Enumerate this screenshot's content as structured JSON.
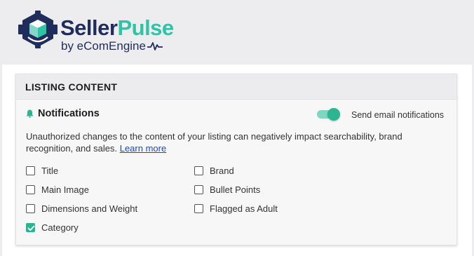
{
  "brand": {
    "name_part1": "Seller",
    "name_part2": "Pulse",
    "sub": "by eComEngine",
    "colors": {
      "navy": "#1f2d5c",
      "teal": "#2ec4a6"
    }
  },
  "card": {
    "header": "LISTING CONTENT",
    "notifications_title": "Notifications",
    "toggle": {
      "label": "Send email notifications",
      "on": true
    },
    "description": "Unauthorized changes to the content of your listing can negatively impact searchability, brand recognition, and sales.",
    "learn_more": "Learn more",
    "options_left": [
      {
        "label": "Title",
        "checked": false
      },
      {
        "label": "Main Image",
        "checked": false
      },
      {
        "label": "Dimensions and Weight",
        "checked": false
      },
      {
        "label": "Category",
        "checked": true
      }
    ],
    "options_right": [
      {
        "label": "Brand",
        "checked": false
      },
      {
        "label": "Bullet Points",
        "checked": false
      },
      {
        "label": "Flagged as Adult",
        "checked": false
      }
    ]
  },
  "icons": {
    "logo": "hexagon-cube-logo",
    "bell": "bell-icon",
    "pulse": "pulse-icon",
    "check": "checkmark-icon"
  }
}
